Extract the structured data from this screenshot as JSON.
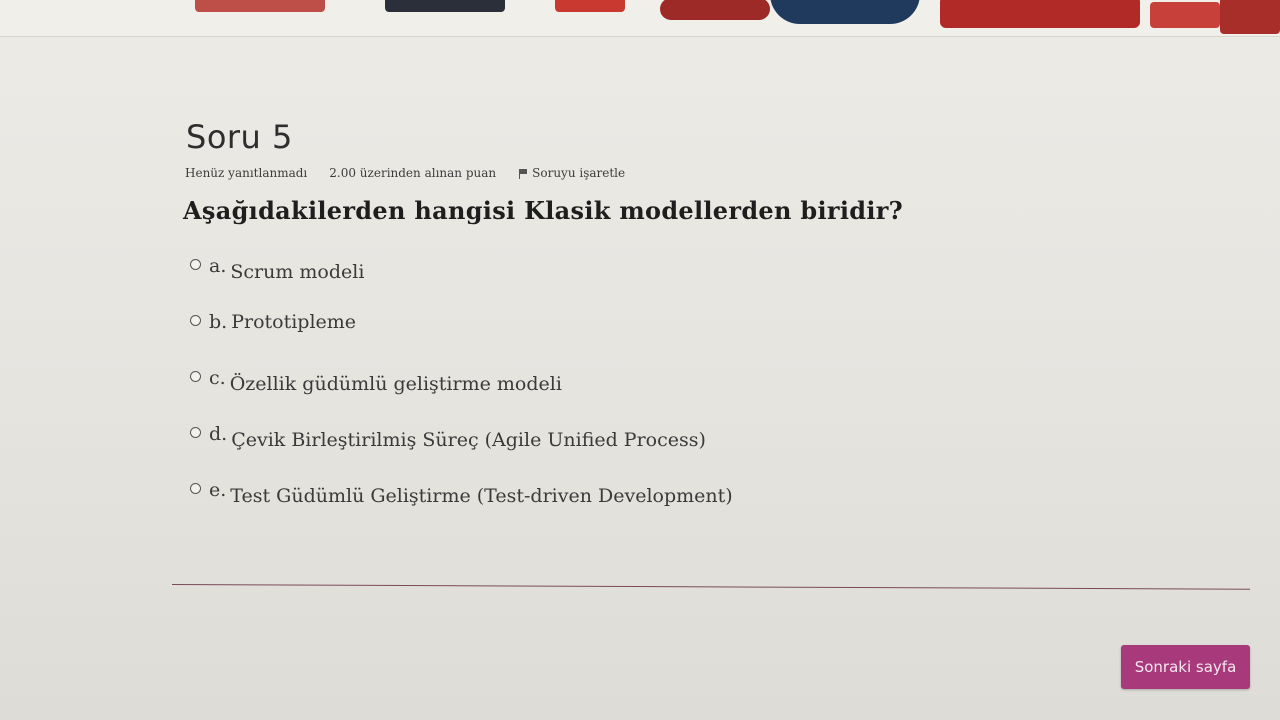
{
  "question": {
    "title": "Soru 5",
    "status": "Henüz yanıtlanmadı",
    "points": "2.00 üzerinden alınan puan",
    "flag_label": "Soruyu işaretle",
    "text": "Aşağıdakilerden hangisi Klasik modellerden biridir?"
  },
  "answers": [
    {
      "letter": "a.",
      "text": "Scrum modeli"
    },
    {
      "letter": "b.",
      "text": "Prototipleme"
    },
    {
      "letter": "c.",
      "text": "Özellik güdümlü geliştirme modeli"
    },
    {
      "letter": "d.",
      "text": "Çevik Birleştirilmiş Süreç (Agile Unified Process)"
    },
    {
      "letter": "e.",
      "text": "Test Güdümlü Geliştirme (Test-driven Development)"
    }
  ],
  "navigation": {
    "next_label": "Sonraki sayfa"
  },
  "colors": {
    "accent": "#a8397a",
    "divider": "#7a4a5a"
  }
}
